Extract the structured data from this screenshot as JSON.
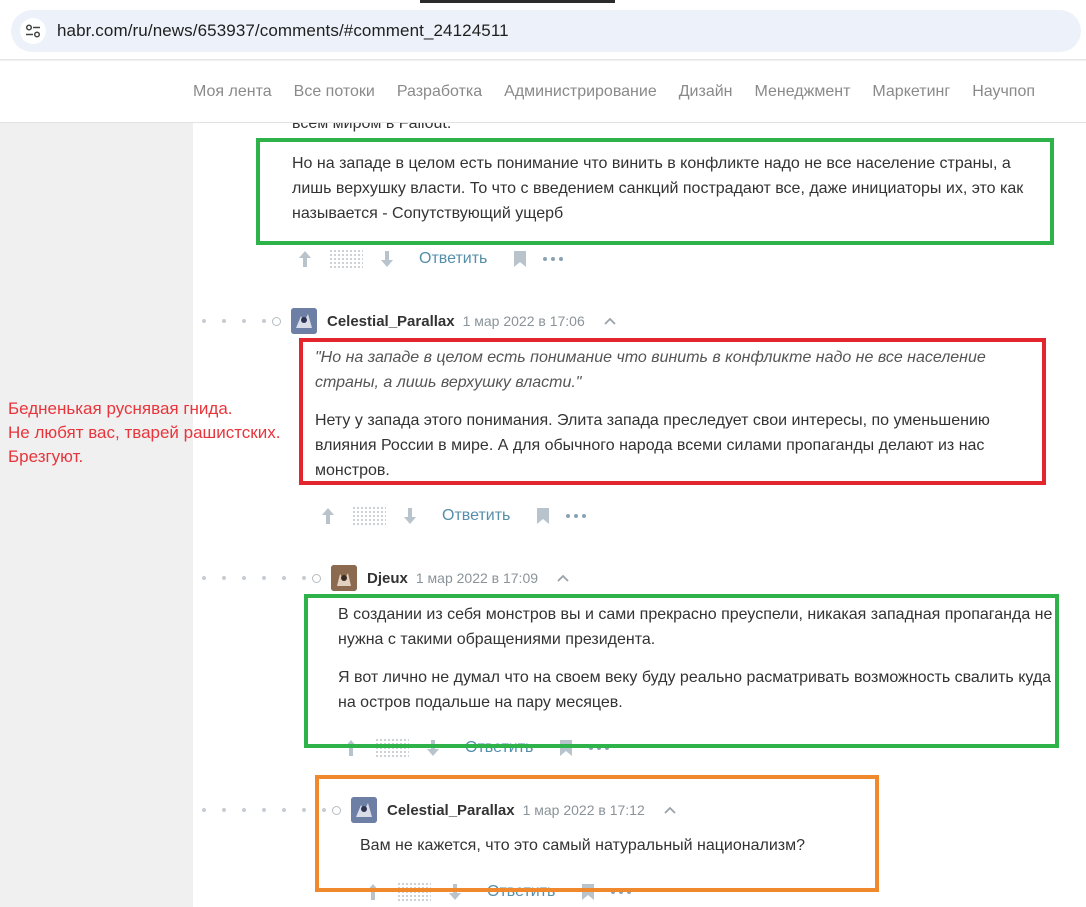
{
  "browser": {
    "url": "habr.com/ru/news/653937/comments/#comment_24124511"
  },
  "nav": {
    "items": [
      "Моя лента",
      "Все потоки",
      "Разработка",
      "Администрирование",
      "Дизайн",
      "Менеджмент",
      "Маркетинг",
      "Научпоп"
    ]
  },
  "cut_text": "всем миром в Fallout.",
  "comments": [
    {
      "paragraphs": [
        "Но на западе в целом есть понимание что винить в конфликте надо не все население страны, а лишь верхушку власти. То что с введением санкций пострадают все, даже инициаторы их, это как называется - Сопутствующий ущерб"
      ],
      "reply_label": "Ответить"
    },
    {
      "author": "Celestial_Parallax",
      "date": "1 мар 2022 в 17:06",
      "quote": "\"Но на западе в целом есть понимание что винить в конфликте надо не все население страны, а лишь верхушку власти.\"",
      "paragraphs": [
        "Нету у запада этого понимания. Элита запада преследует свои интересы, по уменьшению влияния России в мире. А для обычного народа всеми силами пропаганды делают из нас монстров."
      ],
      "reply_label": "Ответить"
    },
    {
      "author": "Djeux",
      "date": "1 мар 2022 в 17:09",
      "paragraphs": [
        "В создании из себя монстров вы и сами прекрасно преуспели, никакая западная пропаганда не нужна с такими обращениями президента.",
        "Я вот лично не думал что на своем веку буду реально расматривать возможность свалить куда на остров подальше на пару месяцев."
      ],
      "reply_label": "Ответить"
    },
    {
      "author": "Celestial_Parallax",
      "date": "1 мар 2022 в 17:12",
      "paragraphs": [
        "Вам не кажется, что это самый натуральный национализм?"
      ],
      "reply_label": "Ответить"
    }
  ],
  "annotation": {
    "lines": [
      "Бедненькая руснявая гнида.",
      "Не любят вас, тварей рашистских.",
      "Брезгуют."
    ]
  },
  "colors": {
    "green_box": "#2db34a",
    "red_box": "#e3262d",
    "orange_box": "#f0892d",
    "annotation_text": "#e8353b",
    "reply_link": "#548eaa"
  }
}
